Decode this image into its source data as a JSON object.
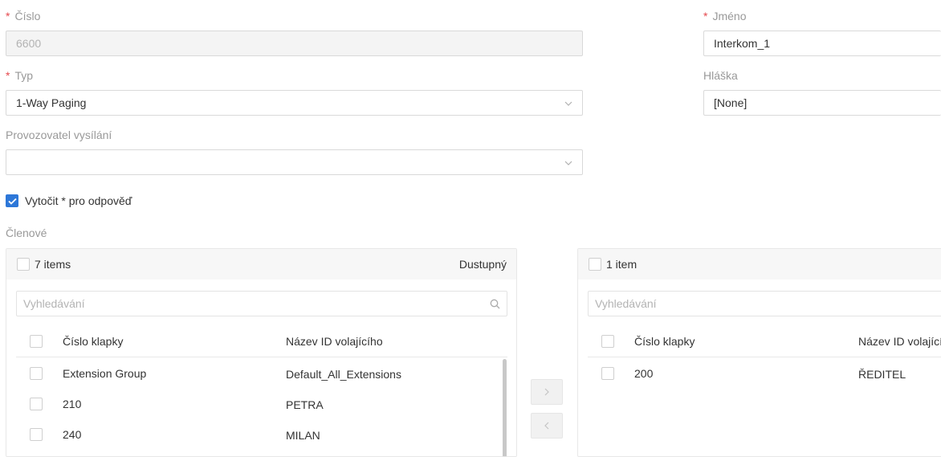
{
  "form": {
    "number": {
      "required_mark": "*",
      "label": "Číslo",
      "value": "6600"
    },
    "name": {
      "required_mark": "*",
      "label": "Jméno",
      "value": "Interkom_1"
    },
    "type": {
      "required_mark": "*",
      "label": "Typ",
      "value": "1-Way Paging"
    },
    "announcement": {
      "label": "Hláška",
      "value": "[None]"
    },
    "broadcaster": {
      "label": "Provozovatel vysílání",
      "value": ""
    },
    "dial_answer": {
      "label": "Vytočit * pro odpověď",
      "checked": true
    },
    "members_label": "Členové"
  },
  "transfer": {
    "left": {
      "count": "7 items",
      "title": "Dustupný",
      "search_placeholder": "Vyhledávání",
      "columns": [
        "Číslo klapky",
        "Název ID volajícího"
      ],
      "rows": [
        {
          "ext": "Extension Group",
          "caller": "Default_All_Extensions"
        },
        {
          "ext": "210",
          "caller": "PETRA"
        },
        {
          "ext": "240",
          "caller": "MILAN"
        }
      ]
    },
    "right": {
      "count": "1 item",
      "search_placeholder": "Vyhledávání",
      "columns": [
        "Číslo klapky",
        "Název ID volajícího"
      ],
      "rows": [
        {
          "ext": "200",
          "caller": "ŘEDITEL"
        }
      ]
    },
    "move_right_icon": "chevron-right-icon",
    "move_left_icon": "chevron-left-icon"
  },
  "colors": {
    "accent": "#2d77d8",
    "required": "#e5484d",
    "label": "#999999"
  }
}
